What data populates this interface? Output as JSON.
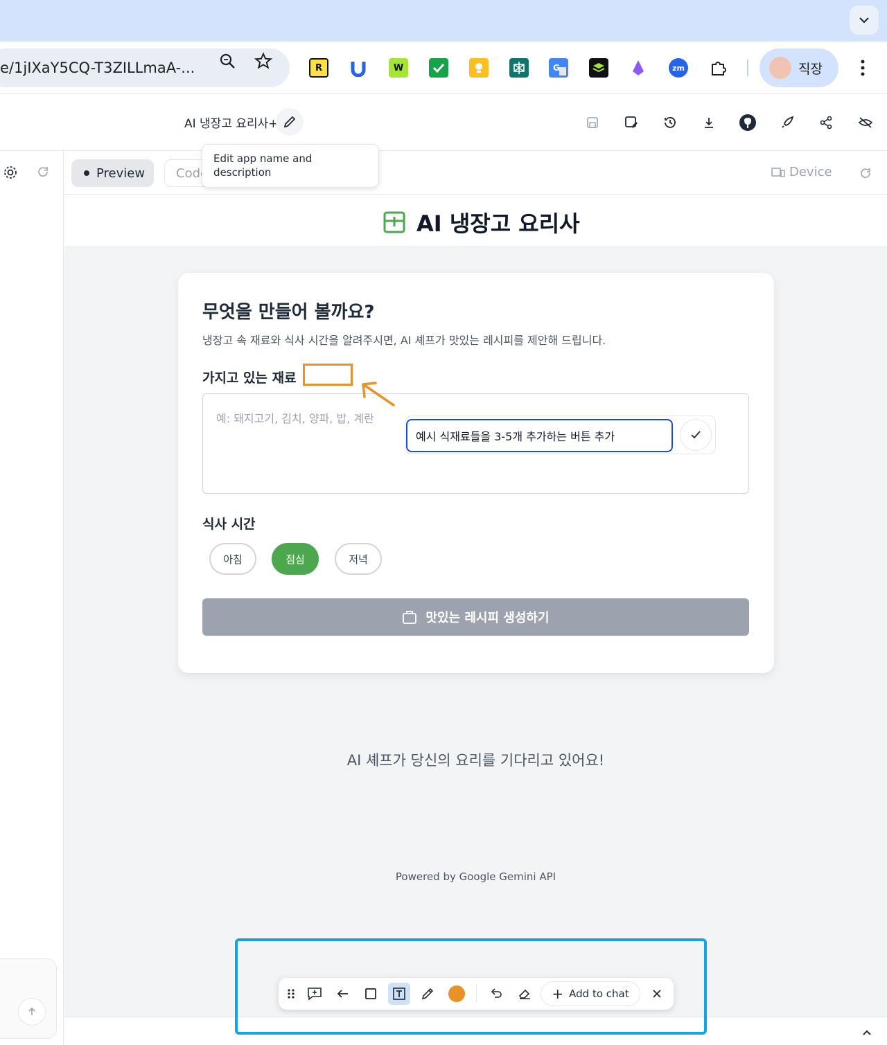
{
  "browser": {
    "url": "e/1jIXaY5CQ-T3ZILLmaA-...",
    "profile_name": "직장",
    "extensions": [
      "readwise-ext-icon",
      "u-ext-icon",
      "w-ext-icon",
      "check-ext-icon",
      "bulb-ext-icon",
      "perplexity-ext-icon",
      "google-translate-icon",
      "stack-ext-icon",
      "gem-ext-icon",
      "zoom-ext-icon",
      "extensions-puzzle-icon"
    ],
    "extension_labels": {
      "readwise": "R",
      "w": "W",
      "zoom": "zm"
    }
  },
  "app_header": {
    "title": "AI 냉장고 요리사+",
    "tooltip": "Edit app name and description",
    "icons": [
      "save-icon",
      "save-as-icon",
      "history-icon",
      "download-icon",
      "github-icon",
      "deploy-icon",
      "share-icon",
      "hide-icon"
    ]
  },
  "preview_bar": {
    "tabs": [
      {
        "label": "Preview",
        "active": true
      },
      {
        "label": "Code",
        "active": false
      }
    ],
    "device_label": "Device"
  },
  "site": {
    "title": "AI 냉장고 요리사",
    "card": {
      "heading": "무엇을 만들어 볼까요?",
      "description": "냉장고 속 재료와 식사 시간을 알려주시면, AI 셰프가 맛있는 레시피를 제안해 드립니다.",
      "ingredients_label": "가지고 있는 재료",
      "ingredients_placeholder": "예: 돼지고기, 김치, 양파, 밥, 계란",
      "meal_label": "식사 시간",
      "meal_options": [
        {
          "label": "아침",
          "selected": false
        },
        {
          "label": "점심",
          "selected": true
        },
        {
          "label": "저녁",
          "selected": false
        }
      ],
      "generate_label": "맛있는 레시피 생성하기"
    },
    "waiting_text": "AI 셰프가 당신의 요리를 기다리고 있어요!",
    "powered_by": "Powered by Google Gemini API"
  },
  "annotation": {
    "comment_text": "예시 식재료들을 3-5개 추가하는 버튼 추가",
    "color": "#e8922a",
    "toolbar": {
      "tools": [
        "drag-handle-icon",
        "comment-icon",
        "arrow-tool-icon",
        "rectangle-tool-icon",
        "text-tool-icon",
        "pen-tool-icon"
      ],
      "selected_tool": "text-tool-icon",
      "add_to_chat_label": "Add to chat"
    }
  },
  "colors": {
    "accent_green": "#4ca74f",
    "annotation_orange": "#e8922a",
    "selection_blue": "#14a3e4",
    "input_focus_blue": "#1d4ed8"
  }
}
